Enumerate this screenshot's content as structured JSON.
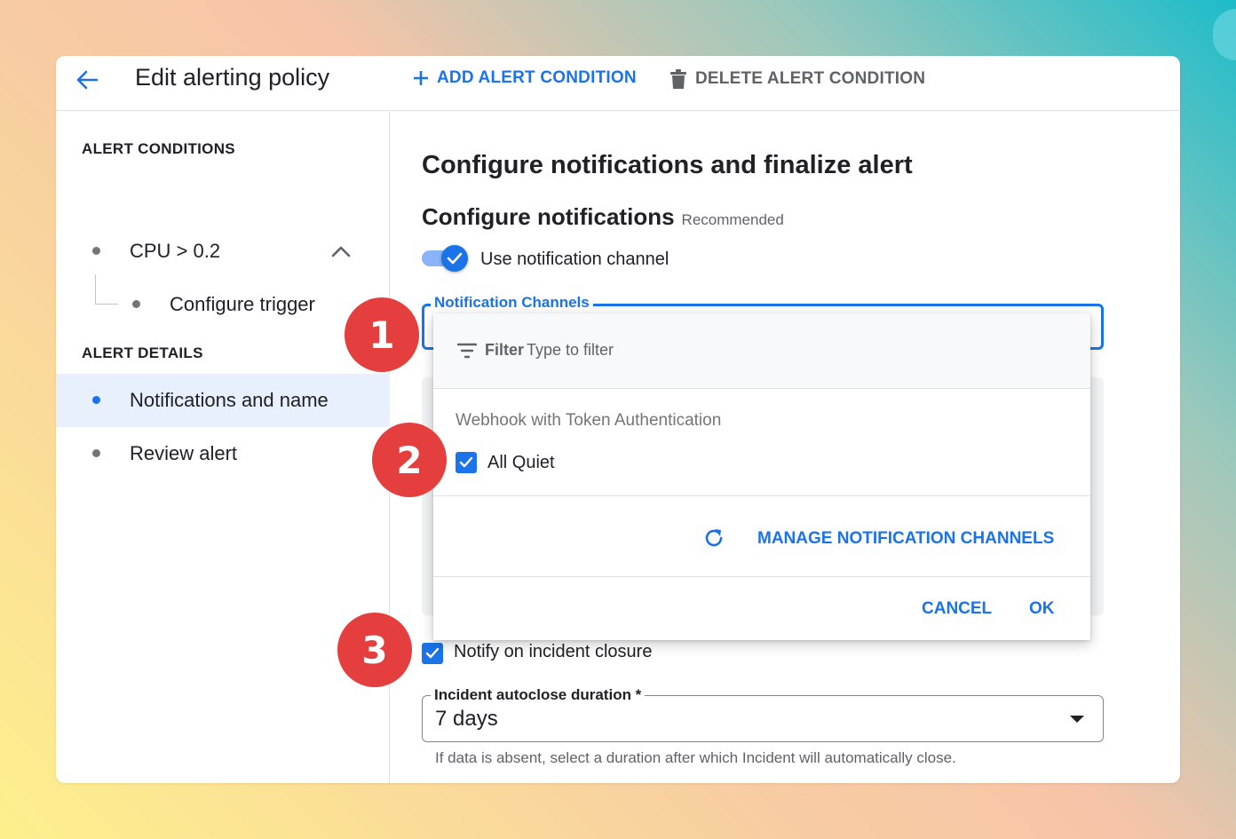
{
  "header": {
    "title": "Edit alerting policy",
    "add_condition_label": "ADD ALERT CONDITION",
    "delete_condition_label": "DELETE ALERT CONDITION"
  },
  "sidebar": {
    "alert_conditions_title": "ALERT CONDITIONS",
    "condition_label": "CPU > 0.2",
    "trigger_label": "Configure trigger",
    "alert_details_title": "ALERT DETAILS",
    "notifications_label": "Notifications and name",
    "review_label": "Review alert"
  },
  "main": {
    "heading": "Configure notifications and finalize alert",
    "subheading": "Configure notifications",
    "recommended": "Recommended",
    "toggle_label": "Use notification channel",
    "channels_legend": "Notification Channels",
    "notify_closure_label": "Notify on incident closure",
    "autoclose_legend": "Incident autoclose duration *",
    "autoclose_value": "7 days",
    "autoclose_helper": "If data is absent, select a duration after which Incident will automatically close."
  },
  "menu": {
    "filter_label": "Filter",
    "filter_placeholder": "Type to filter",
    "group_title": "Webhook with Token Authentication",
    "option_label": "All Quiet",
    "manage_label": "MANAGE NOTIFICATION CHANNELS",
    "cancel_label": "CANCEL",
    "ok_label": "OK"
  },
  "badges": [
    "1",
    "2",
    "3"
  ],
  "colors": {
    "accent": "#1a73e8",
    "badge": "#e53e3e",
    "active_nav_bg": "#e8f0fe"
  }
}
